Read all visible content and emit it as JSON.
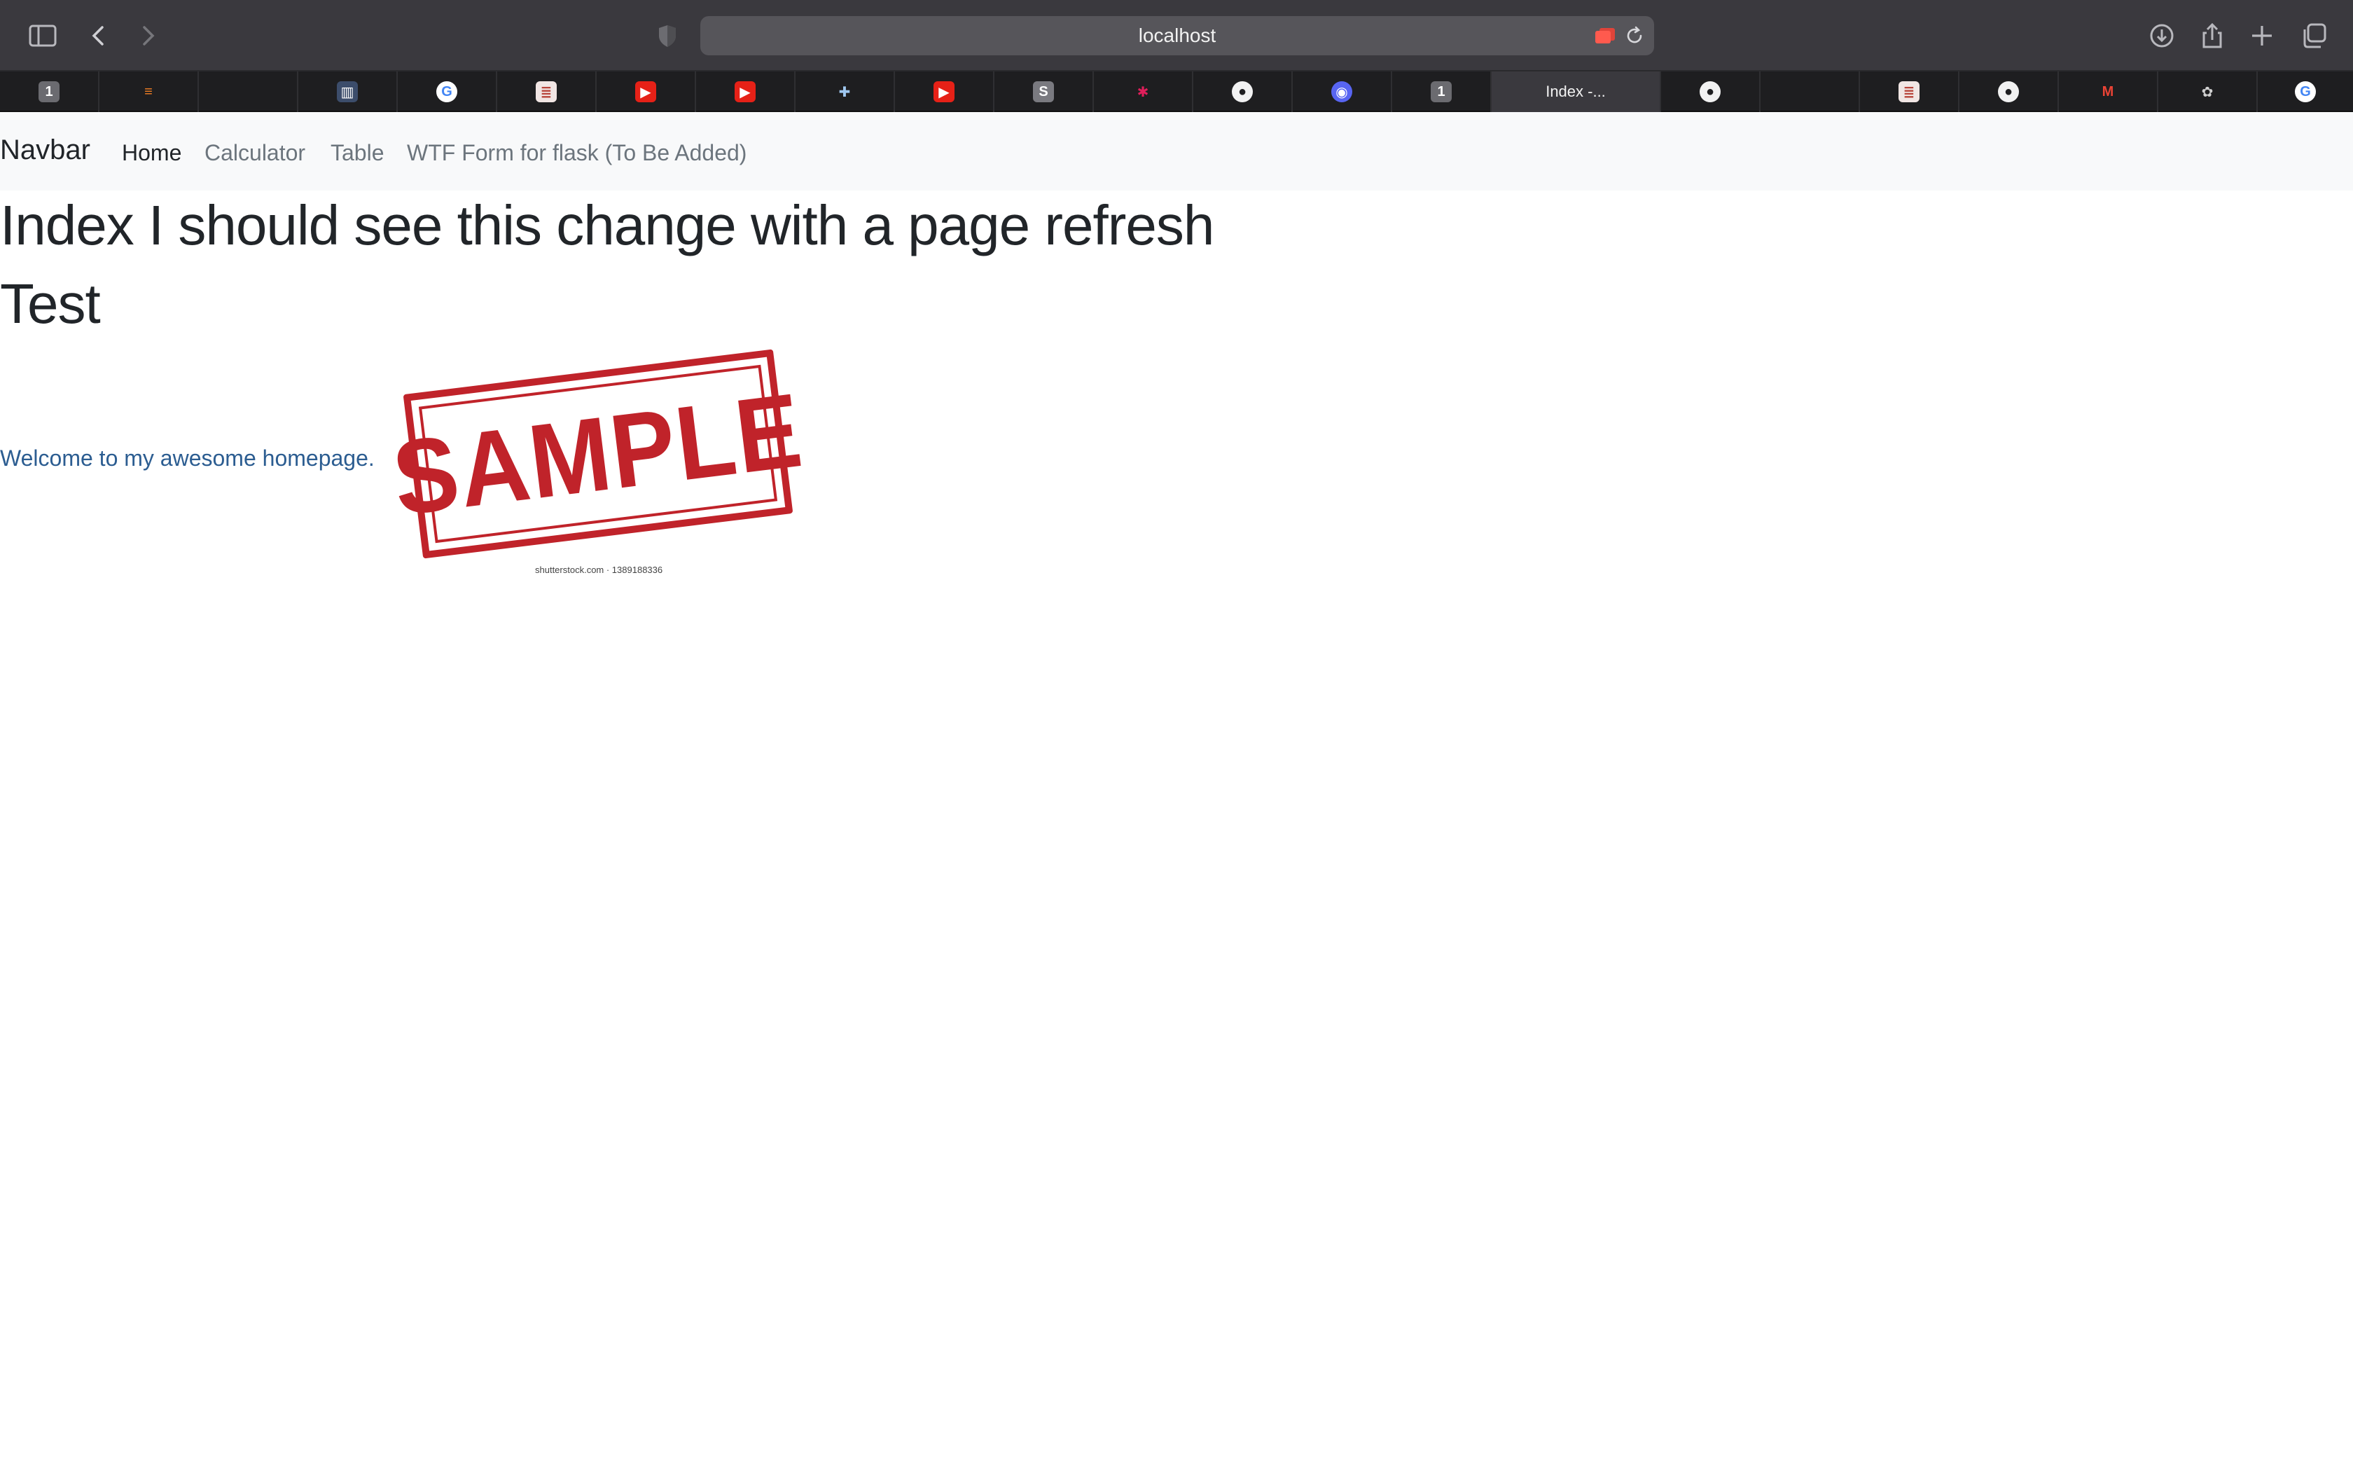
{
  "browser": {
    "url": "localhost",
    "active_tab_title": "Index -...",
    "tabs": [
      {
        "icon": "onepassword-icon",
        "glyph": "1",
        "color": "#6b6b70"
      },
      {
        "icon": "stackoverflow-icon",
        "glyph": "≡",
        "color": "#f48024"
      },
      {
        "icon": "blank-tab-icon",
        "glyph": "",
        "color": "#1e1e20"
      },
      {
        "icon": "columns-icon",
        "glyph": "▥",
        "color": "#3c4d6b"
      },
      {
        "icon": "google-icon",
        "glyph": "G",
        "color": "#4285f4"
      },
      {
        "icon": "nyu-icon",
        "glyph": "≣",
        "color": "#b8453b"
      },
      {
        "icon": "youtube-icon",
        "glyph": "▶",
        "color": "#e62117"
      },
      {
        "icon": "youtube-icon",
        "glyph": "▶",
        "color": "#e62117"
      },
      {
        "icon": "python-icon",
        "glyph": "✚",
        "color": "#3b7bbf"
      },
      {
        "icon": "youtube-icon",
        "glyph": "▶",
        "color": "#e62117"
      },
      {
        "icon": "scribd-icon",
        "glyph": "S",
        "color": "#7a7a80"
      },
      {
        "icon": "slack-icon",
        "glyph": "✱",
        "color": "#4a154b"
      },
      {
        "icon": "github-icon",
        "glyph": "●",
        "color": "#f2f2f2"
      },
      {
        "icon": "discord-icon",
        "glyph": "◉",
        "color": "#5865f2"
      },
      {
        "icon": "onepassword-icon",
        "glyph": "1",
        "color": "#6b6b70"
      },
      {
        "icon": "active-tab",
        "glyph": "",
        "color": "#3a393e"
      },
      {
        "icon": "github-icon",
        "glyph": "●",
        "color": "#f2f2f2"
      },
      {
        "icon": "blank-tab-icon",
        "glyph": "",
        "color": "#1e1e20"
      },
      {
        "icon": "nyu-icon",
        "glyph": "≣",
        "color": "#b8453b"
      },
      {
        "icon": "github-icon",
        "glyph": "●",
        "color": "#f2f2f2"
      },
      {
        "icon": "gmail-icon",
        "glyph": "M",
        "color": "#ea4335"
      },
      {
        "icon": "openai-icon",
        "glyph": "✿",
        "color": "#d0d0d0"
      },
      {
        "icon": "google-icon",
        "glyph": "G",
        "color": "#4285f4"
      }
    ]
  },
  "navbar": {
    "brand": "Navbar",
    "links": [
      "Home",
      "Calculator",
      "Table",
      "WTF Form for flask (To Be Added)"
    ]
  },
  "page": {
    "heading1": "Index I should see this change with a page refresh",
    "heading2": "Test",
    "welcome": "Welcome to my awesome homepage.",
    "stamp_text": "SAMPLE",
    "stamp_caption": "shutterstock.com · 1389188336"
  }
}
